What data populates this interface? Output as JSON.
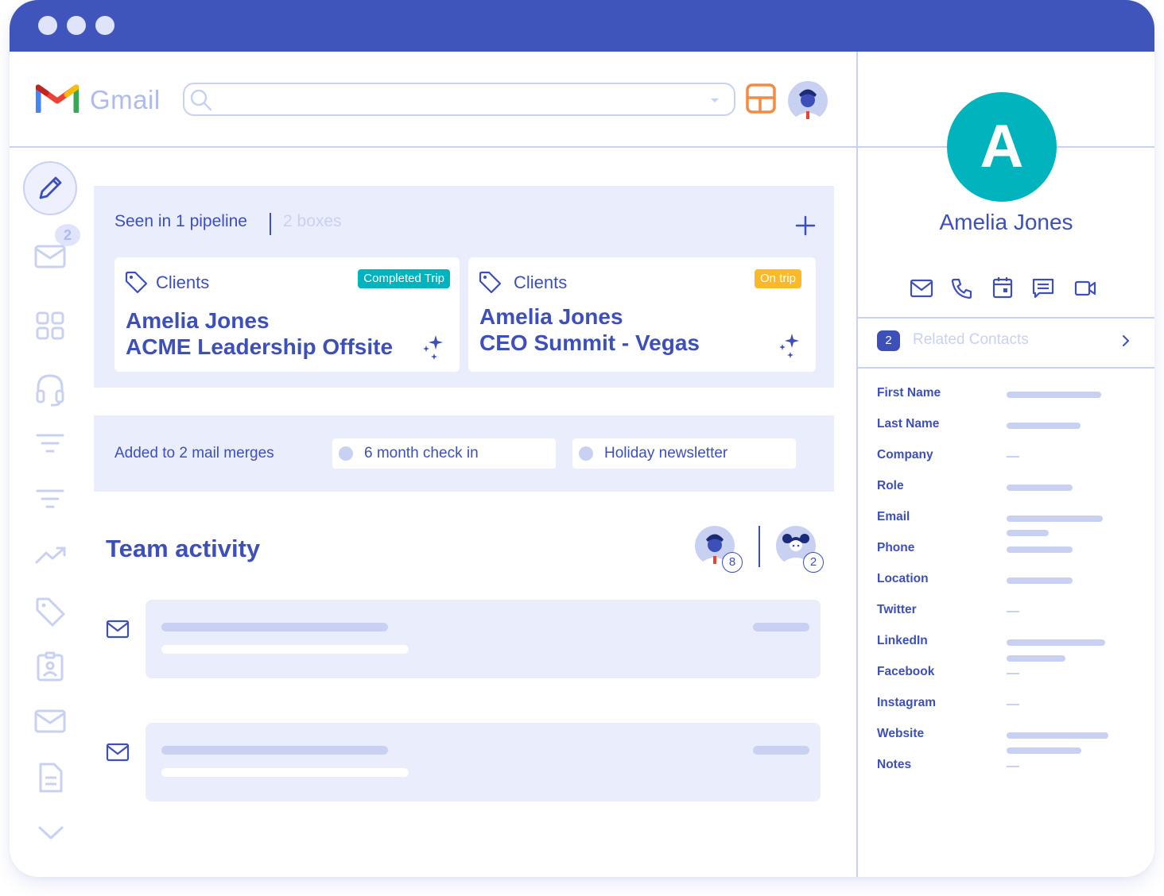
{
  "app": {
    "name": "Gmail"
  },
  "colors": {
    "primary": "#3d4fb8",
    "titlebar": "#3f55bb",
    "light": "#c9d1f2",
    "panel": "#eaedfc",
    "teal": "#00b3bd",
    "amber": "#fbb829",
    "orange": "#f58a40"
  },
  "search": {
    "placeholder": ""
  },
  "sidebar": {
    "inbox_badge": "2",
    "icons": [
      "compose-icon",
      "inbox-icon",
      "grid-icon",
      "headset-icon",
      "filter-icon",
      "filter-icon",
      "trend-icon",
      "tag-icon",
      "contact-badge-icon",
      "mail-icon",
      "document-icon",
      "chevron-down-icon"
    ]
  },
  "pipeline": {
    "seen_text": "Seen in 1 pipeline",
    "boxes_text": "2 boxes",
    "cards": [
      {
        "pipeline_name": "Clients",
        "stage": "Completed Trip",
        "stage_color": "#00b3bd",
        "line1": "Amelia Jones",
        "line2": "ACME Leadership Offsite"
      },
      {
        "pipeline_name": "Clients",
        "stage": "On trip",
        "stage_color": "#fbb829",
        "line1": "Amelia Jones",
        "line2": "CEO Summit - Vegas"
      }
    ]
  },
  "mail_merges": {
    "label": "Added to 2 mail merges",
    "items": [
      "6 month check in",
      "Holiday newsletter"
    ]
  },
  "team_activity": {
    "title": "Team activity",
    "members": [
      {
        "count": "8"
      },
      {
        "count": "2"
      }
    ]
  },
  "contact": {
    "initial": "A",
    "name": "Amelia Jones",
    "actions": [
      "email-icon",
      "phone-icon",
      "calendar-icon",
      "message-icon",
      "video-icon"
    ],
    "related": {
      "count": "2",
      "label": "Related Contacts"
    },
    "fields": [
      "First Name",
      "Last Name",
      "Company",
      "Role",
      "Email",
      "Phone",
      "Location",
      "Twitter",
      "LinkedIn",
      "Facebook",
      "Instagram",
      "Website",
      "Notes"
    ]
  }
}
